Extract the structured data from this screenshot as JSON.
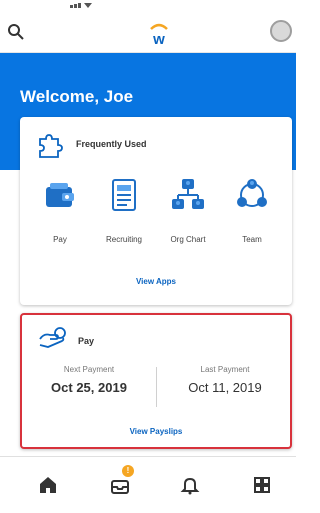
{
  "header": {
    "welcome": "Welcome, Joe",
    "logo_letter": "w"
  },
  "frequently_used": {
    "title": "Frequently Used",
    "apps": [
      {
        "label": "Pay",
        "icon": "wallet-icon"
      },
      {
        "label": "Recruiting",
        "icon": "document-icon"
      },
      {
        "label": "Org Chart",
        "icon": "org-chart-icon"
      },
      {
        "label": "Team",
        "icon": "team-icon"
      }
    ],
    "view_apps": "View Apps"
  },
  "pay": {
    "title": "Pay",
    "next_caption": "Next Payment",
    "next_date": "Oct 25, 2019",
    "last_caption": "Last Payment",
    "last_date": "Oct 11, 2019",
    "view_payslips": "View Payslips"
  },
  "bottom_nav": {
    "inbox_badge": "!"
  },
  "colors": {
    "brand_blue": "#0875e1",
    "highlight_red": "#d8323c",
    "badge_orange": "#f5a623"
  }
}
